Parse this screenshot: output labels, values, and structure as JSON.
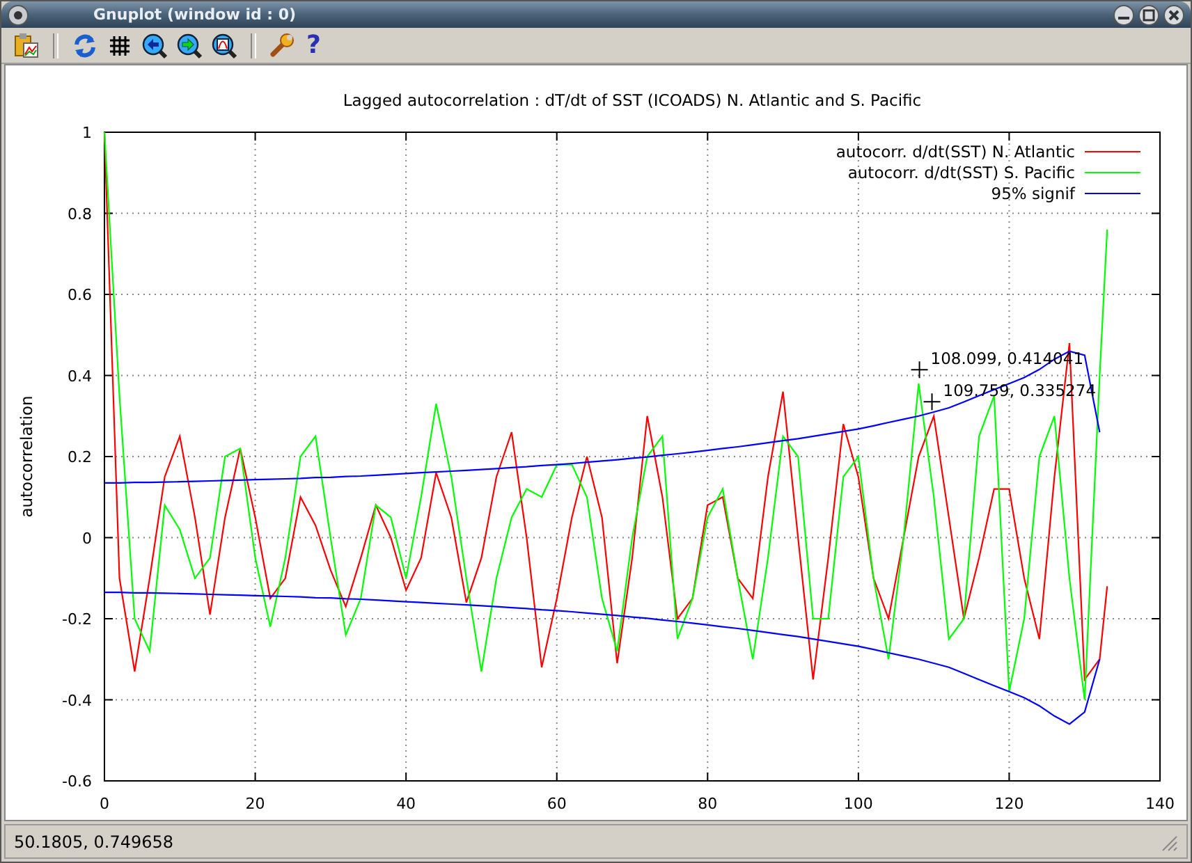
{
  "window": {
    "title": "Gnuplot (window id : 0)"
  },
  "toolbar": [
    {
      "kind": "copy"
    },
    {
      "kind": "separator"
    },
    {
      "kind": "replot"
    },
    {
      "kind": "grid"
    },
    {
      "kind": "zoom-back"
    },
    {
      "kind": "zoom-forward"
    },
    {
      "kind": "zoom-fit"
    },
    {
      "kind": "separator"
    },
    {
      "kind": "settings"
    },
    {
      "kind": "help",
      "glyph": "?"
    }
  ],
  "plot": {
    "chart_data": {
      "type": "line",
      "title": "Lagged autocorrelation :  dT/dt of SST (ICOADS) N. Atlantic and S. Pacific",
      "ylabel": "autocorrelation",
      "xlim": [
        0,
        140
      ],
      "ylim": [
        -0.6,
        1
      ],
      "grid": true,
      "legend": true,
      "xticks": [
        0,
        20,
        40,
        60,
        80,
        100,
        120,
        140
      ],
      "yticks": [
        -0.6,
        -0.4,
        -0.2,
        0,
        0.2,
        0.4,
        0.6,
        0.8,
        1
      ],
      "x": [
        0,
        2,
        4,
        6,
        8,
        10,
        12,
        14,
        16,
        18,
        20,
        22,
        24,
        26,
        28,
        30,
        32,
        34,
        36,
        38,
        40,
        42,
        44,
        46,
        48,
        50,
        52,
        54,
        56,
        58,
        60,
        62,
        64,
        66,
        68,
        70,
        72,
        74,
        76,
        78,
        80,
        82,
        84,
        86,
        88,
        90,
        92,
        94,
        96,
        98,
        100,
        102,
        104,
        106,
        108,
        110,
        112,
        114,
        116,
        118,
        120,
        122,
        124,
        126,
        128,
        130,
        132,
        133
      ],
      "series": [
        {
          "name": "autocorr. d/dt(SST) N. Atlantic",
          "color": "#ff0000",
          "values": [
            1,
            -0.1,
            -0.33,
            -0.1,
            0.15,
            0.25,
            0.05,
            -0.19,
            0.05,
            0.22,
            0.05,
            -0.15,
            -0.1,
            0.1,
            0.03,
            -0.08,
            -0.17,
            -0.05,
            0.08,
            0,
            -0.13,
            -0.05,
            0.16,
            0.05,
            -0.16,
            -0.05,
            0.15,
            0.26,
            0,
            -0.32,
            -0.15,
            0.05,
            0.2,
            0.05,
            -0.31,
            -0.05,
            0.3,
            0.1,
            -0.2,
            -0.15,
            0.08,
            0.1,
            -0.1,
            -0.15,
            0.15,
            0.36,
            0,
            -0.35,
            -0.05,
            0.28,
            0.15,
            -0.1,
            -0.2,
            0,
            0.2,
            0.3,
            0.05,
            -0.2,
            -0.05,
            0.12,
            0.12,
            -0.1,
            -0.25,
            0.15,
            0.48,
            -0.35,
            -0.3,
            -0.12
          ]
        },
        {
          "name": "autocorr. d/dt(SST) S. Pacific",
          "color": "#00ff00",
          "values": [
            1,
            0.35,
            -0.2,
            -0.28,
            0.08,
            0.02,
            -0.1,
            -0.05,
            0.2,
            0.22,
            -0.05,
            -0.22,
            -0.05,
            0.2,
            0.25,
            0,
            -0.24,
            -0.15,
            0.08,
            0.05,
            -0.1,
            0.1,
            0.33,
            0.15,
            -0.1,
            -0.33,
            -0.1,
            0.05,
            0.12,
            0.1,
            0.18,
            0.18,
            0.1,
            -0.15,
            -0.28,
            0,
            0.2,
            0.25,
            -0.25,
            -0.15,
            0.05,
            0.12,
            -0.1,
            -0.3,
            -0.05,
            0.25,
            0.2,
            -0.2,
            -0.2,
            0.15,
            0.2,
            -0.1,
            -0.3,
            0,
            0.38,
            0.1,
            -0.25,
            -0.2,
            0.25,
            0.35,
            -0.38,
            -0.2,
            0.2,
            0.3,
            -0.1,
            -0.4,
            0.4,
            0.76
          ]
        },
        {
          "name": "95% signif",
          "color": "#0000ff",
          "values": [
            0.135,
            0.135,
            0.136,
            0.136,
            0.137,
            0.138,
            0.139,
            0.14,
            0.141,
            0.142,
            0.143,
            0.144,
            0.145,
            0.146,
            0.148,
            0.149,
            0.151,
            0.152,
            0.154,
            0.156,
            0.158,
            0.16,
            0.162,
            0.164,
            0.166,
            0.168,
            0.17,
            0.173,
            0.175,
            0.178,
            0.18,
            0.183,
            0.186,
            0.189,
            0.192,
            0.196,
            0.199,
            0.203,
            0.207,
            0.211,
            0.215,
            0.22,
            0.224,
            0.229,
            0.234,
            0.239,
            0.244,
            0.25,
            0.256,
            0.262,
            0.268,
            0.276,
            0.284,
            0.292,
            0.3,
            0.31,
            0.32,
            0.335,
            0.35,
            0.365,
            0.38,
            0.395,
            0.415,
            0.44,
            0.46,
            0.45,
            0.26,
            null
          ]
        },
        {
          "color": "#0000ff",
          "values": [
            -0.135,
            -0.135,
            -0.136,
            -0.136,
            -0.137,
            -0.138,
            -0.139,
            -0.14,
            -0.141,
            -0.142,
            -0.143,
            -0.144,
            -0.145,
            -0.146,
            -0.148,
            -0.149,
            -0.151,
            -0.152,
            -0.154,
            -0.156,
            -0.158,
            -0.16,
            -0.162,
            -0.164,
            -0.166,
            -0.168,
            -0.17,
            -0.173,
            -0.175,
            -0.178,
            -0.18,
            -0.183,
            -0.186,
            -0.189,
            -0.192,
            -0.196,
            -0.199,
            -0.203,
            -0.207,
            -0.211,
            -0.215,
            -0.22,
            -0.224,
            -0.229,
            -0.234,
            -0.239,
            -0.244,
            -0.25,
            -0.256,
            -0.262,
            -0.268,
            -0.276,
            -0.284,
            -0.292,
            -0.3,
            -0.31,
            -0.32,
            -0.335,
            -0.35,
            -0.365,
            -0.38,
            -0.395,
            -0.415,
            -0.44,
            -0.46,
            -0.43,
            -0.3,
            null
          ]
        }
      ],
      "annotations": [
        "108.099,  0.414041",
        "109.759,  0.335274"
      ]
    }
  },
  "status_bar": {
    "text": "50.1805,  0.749658"
  }
}
